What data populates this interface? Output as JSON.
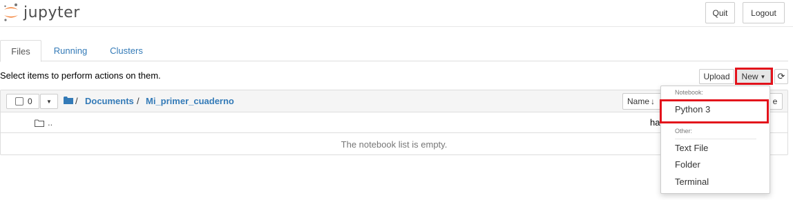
{
  "header": {
    "logo_text": "jupyter",
    "quit_label": "Quit",
    "logout_label": "Logout"
  },
  "tabs": [
    {
      "label": "Files"
    },
    {
      "label": "Running"
    },
    {
      "label": "Clusters"
    }
  ],
  "toolbar": {
    "hint": "Select items to perform actions on them.",
    "upload_label": "Upload",
    "new_label": "New",
    "selected_count": "0"
  },
  "breadcrumb": {
    "separator": "/",
    "items": [
      "Documents",
      "Mi_primer_cuaderno"
    ]
  },
  "list": {
    "parent_dir_label": "..",
    "sort_name_label": "Name",
    "right_partial_text": "ha",
    "empty_message": "The notebook list is empty."
  },
  "new_menu": {
    "notebook_header": "Notebook:",
    "python_label": "Python 3",
    "other_header": "Other:",
    "text_file_label": "Text File",
    "folder_label": "Folder",
    "terminal_label": "Terminal",
    "partial_right_text": "e"
  },
  "colors": {
    "link": "#337ab7",
    "highlight": "#e3121b",
    "logo_orange": "#f37726"
  }
}
